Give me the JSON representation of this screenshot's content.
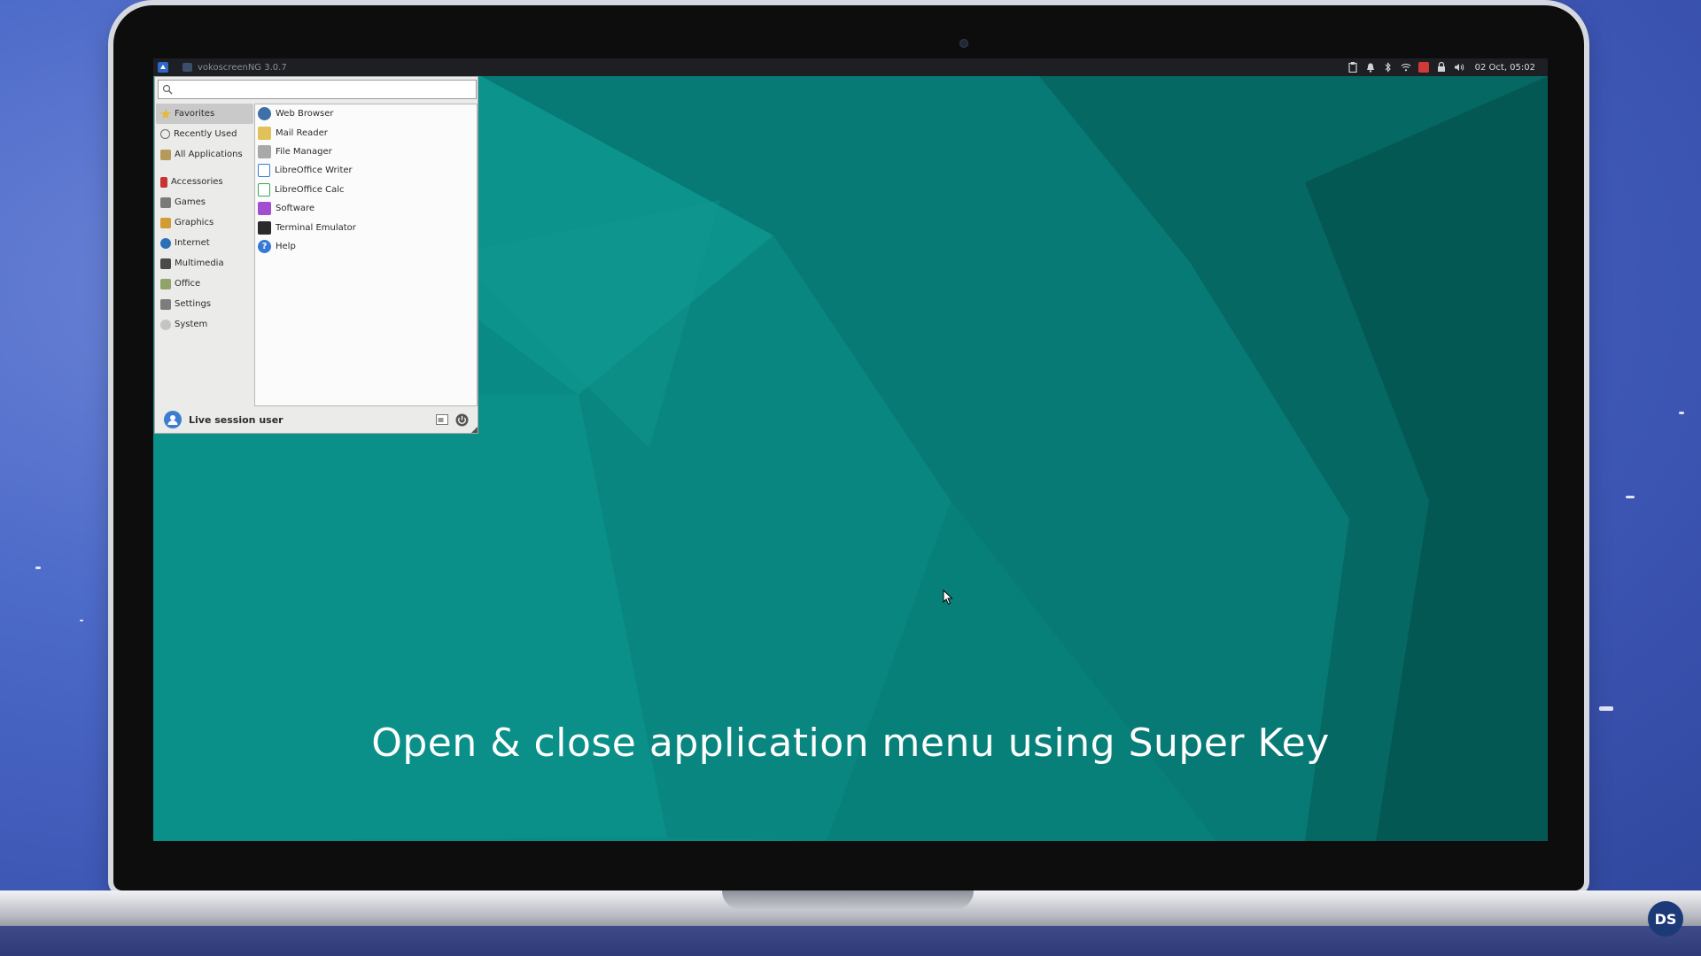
{
  "panel": {
    "task_title": "vokoscreenNG 3.0.7",
    "clock": "02 Oct, 05:02",
    "tray_icons": [
      "clipboard-icon",
      "bell-icon",
      "bluetooth-icon",
      "wifi-icon",
      "red-app-icon",
      "lock-icon",
      "volume-icon"
    ]
  },
  "menu": {
    "search": {
      "value": "",
      "placeholder": ""
    },
    "categories": [
      {
        "label": "Favorites",
        "icon": "star-icon",
        "color": "#e7b83a"
      },
      {
        "label": "Recently Used",
        "icon": "clock-icon",
        "color": "#6a6a6a"
      },
      {
        "label": "All Applications",
        "icon": "folder-icon",
        "color": "#b59a5c"
      },
      {
        "label": "Accessories",
        "icon": "accessories-icon",
        "color": "#c8342f"
      },
      {
        "label": "Games",
        "icon": "games-icon",
        "color": "#7a7a7a"
      },
      {
        "label": "Graphics",
        "icon": "graphics-icon",
        "color": "#d49a33"
      },
      {
        "label": "Internet",
        "icon": "globe-icon",
        "color": "#2c6fb9"
      },
      {
        "label": "Multimedia",
        "icon": "multimedia-icon",
        "color": "#4a4a4a"
      },
      {
        "label": "Office",
        "icon": "office-icon",
        "color": "#8fa36a"
      },
      {
        "label": "Settings",
        "icon": "settings-icon",
        "color": "#7d7d7d"
      },
      {
        "label": "System",
        "icon": "system-icon",
        "color": "#9a9a9a"
      }
    ],
    "apps": [
      {
        "label": "Web Browser",
        "icon": "web-browser-icon",
        "color": "#3f6fa8"
      },
      {
        "label": "Mail Reader",
        "icon": "mail-icon",
        "color": "#e2c15a"
      },
      {
        "label": "File Manager",
        "icon": "file-manager-icon",
        "color": "#a9a9a9"
      },
      {
        "label": "LibreOffice Writer",
        "icon": "writer-icon",
        "color": "#3a7bd5"
      },
      {
        "label": "LibreOffice Calc",
        "icon": "calc-icon",
        "color": "#3aa55a"
      },
      {
        "label": "Software",
        "icon": "software-icon",
        "color": "#a14fd0"
      },
      {
        "label": "Terminal Emulator",
        "icon": "terminal-icon",
        "color": "#2b2b2b"
      },
      {
        "label": "Help",
        "icon": "help-icon",
        "color": "#3479d4"
      }
    ],
    "user_name": "Live session user"
  },
  "caption": "Open & close application menu using Super Key",
  "badge": "DS"
}
